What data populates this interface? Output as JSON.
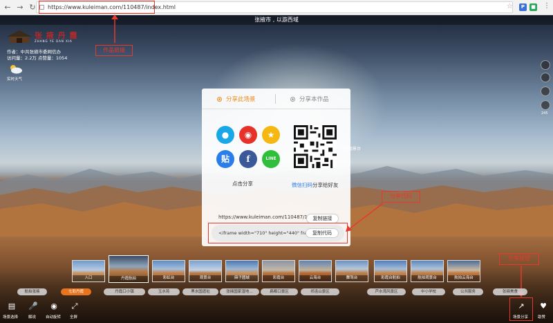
{
  "browser": {
    "url": "https://www.kuleiman.com/110487/index.html"
  },
  "annotations": {
    "work_link": "作品链接",
    "share_code": "分享代码",
    "share_button": "分享按钮"
  },
  "scene": {
    "title": "张掖市 , 以游西域"
  },
  "info": {
    "logo_text": "张 掖 丹 霞",
    "logo_sub": "ZHANG YE DAN XIA",
    "author": "作者：中共张掖市委网信办",
    "stats": "访问量：2.2万   点赞量：1054",
    "weather_label": "实时天气",
    "hotspot": "丹霞观景台"
  },
  "share_panel": {
    "tab_scene": "分享此场景",
    "tab_work": "分享本作品",
    "click_share": "点击分享",
    "scan_prefix": "微信扫码",
    "scan_suffix": "分享给好友",
    "share_url": "https://www.kuleiman.com/110487/17895",
    "copy_link": "复制链接",
    "iframe_code": "<iframe width=\"710\" height=\"440\" frameb",
    "copy_code": "复制代码",
    "icons": [
      "qq-icon",
      "weibo-icon",
      "qzone-icon",
      "tieba-icon",
      "facebook-icon",
      "line-icon"
    ]
  },
  "thumbnails": [
    {
      "label": "入口"
    },
    {
      "label": "丹霞航拍"
    },
    {
      "label": "彩虹台"
    },
    {
      "label": "观景台"
    },
    {
      "label": "麻子圆城"
    },
    {
      "label": "彩霞台"
    },
    {
      "label": "云海台"
    },
    {
      "label": "舞驾台"
    },
    {
      "label": "彩霞台航拍"
    },
    {
      "label": "航拍观景台"
    },
    {
      "label": "航拍云海台"
    }
  ],
  "categories": [
    {
      "label": "航拍张掖",
      "active": false
    },
    {
      "label": "七彩丹霞",
      "active": true
    },
    {
      "label": "丹霞口小镇",
      "active": false
    },
    {
      "label": "玉水苑",
      "active": false
    },
    {
      "label": "黑水国遗址",
      "active": false
    },
    {
      "label": "张掖国家湿地…",
      "active": false
    },
    {
      "label": "扁都口景区",
      "active": false
    },
    {
      "label": "祁连山景区",
      "active": false
    },
    {
      "label": "芦水湾风景区",
      "active": false
    },
    {
      "label": "中小学校",
      "active": false
    },
    {
      "label": "公共服务",
      "active": false
    },
    {
      "label": "张掖美食",
      "active": false
    }
  ],
  "toolbar": {
    "scene_select": "场景选择",
    "narration": "解说",
    "auto_rotate": "自动旋转",
    "fullscreen": "全屏",
    "scene_share": "场景分享",
    "like": "助赞"
  },
  "right_side": {
    "count": "245"
  }
}
